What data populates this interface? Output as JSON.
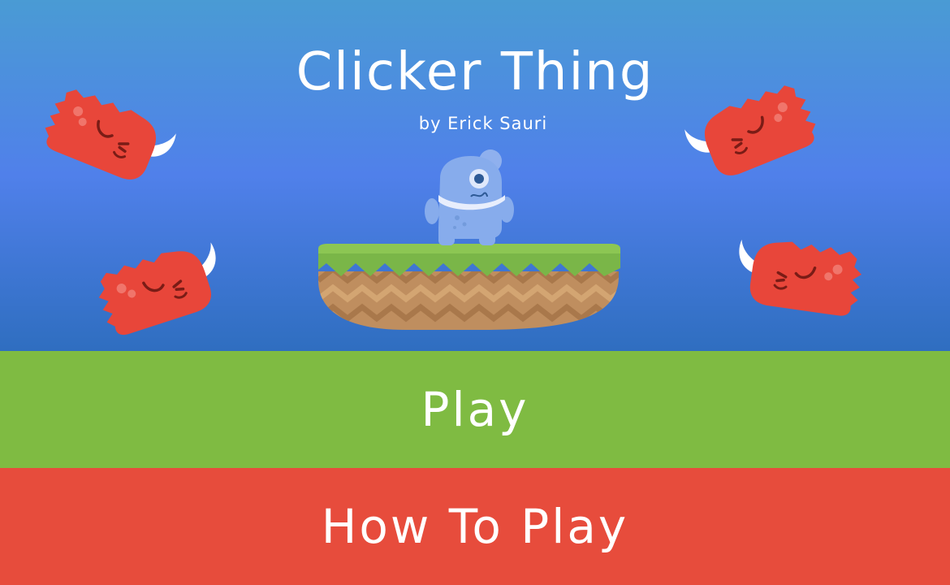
{
  "game": {
    "title": "Clicker Thing",
    "subtitle": "by Erick Sauri"
  },
  "menu": {
    "play_label": "Play",
    "how_to_play_label": "How To Play"
  },
  "colors": {
    "sky_top": "#4a9bd4",
    "sky_mid": "#5080ea",
    "sky_bottom": "#2f6ec0",
    "play_green": "#7fbb42",
    "how_to_red": "#e74c3c",
    "monster_red": "#e8463a",
    "hero_blue": "#87acec",
    "grass": "#7ab648",
    "dirt": "#bf8e5f"
  },
  "icons": {
    "hero": "one-eyed-blue-creature-icon",
    "enemy": "red-horned-monster-icon",
    "platform": "floating-grass-island-icon"
  }
}
